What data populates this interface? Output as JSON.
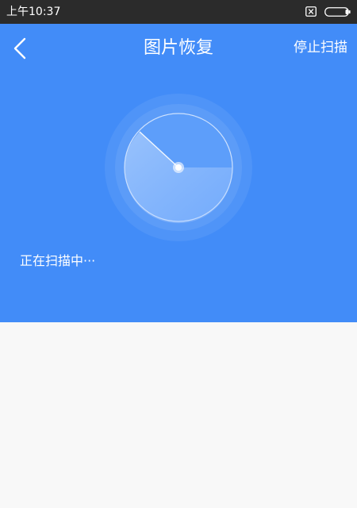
{
  "status_bar": {
    "time": "上午10:37",
    "icons": [
      "sim-card-missing-icon",
      "battery-icon"
    ]
  },
  "header": {
    "title": "图片恢复",
    "back_icon": "chevron-left-icon",
    "stop_scan_label": "停止扫描"
  },
  "scanner": {
    "radar_icon": "radar-scan-icon",
    "status_text": "正在扫描中···"
  },
  "colors": {
    "status_bar_bg": "#2b2b2b",
    "header_bg": "#428cf8",
    "content_bg": "#f8f8f8",
    "text_on_header": "#ffffff"
  }
}
